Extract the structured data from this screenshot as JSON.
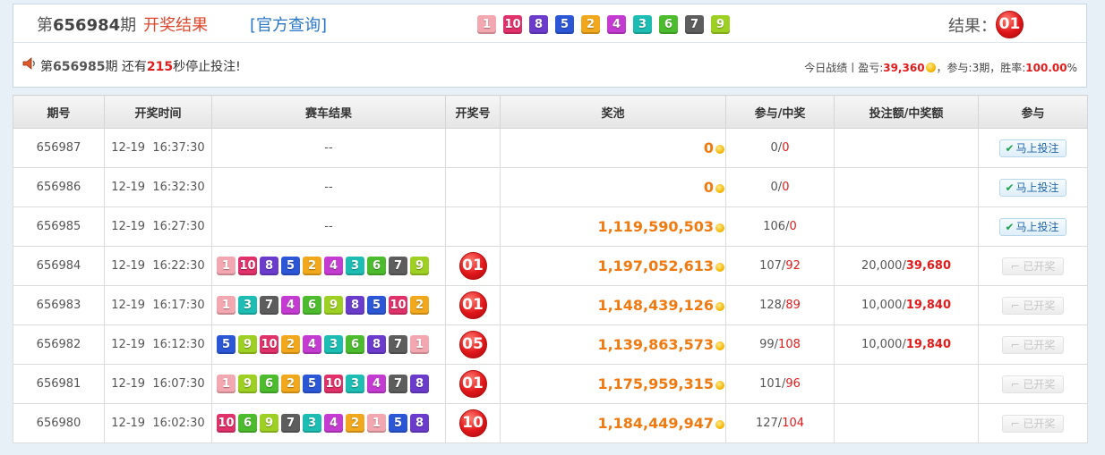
{
  "colors": {
    "1": "#f3a7b0",
    "2": "#f2a81c",
    "3": "#1dbdb3",
    "4": "#c33bd0",
    "5": "#2b57d6",
    "6": "#4cbc2e",
    "7": "#5d5d5d",
    "8": "#6b3ccc",
    "9": "#9dd022",
    "10": "#e0316a",
    "accent_red": "#e21b1b",
    "pool_orange": "#f07a10",
    "link_blue": "#2a76c8"
  },
  "header": {
    "issue_prefix": "第",
    "issue_number": "656984",
    "issue_suffix": "期",
    "result_title": "开奖结果",
    "official_link": "[官方查询]",
    "balls": [
      1,
      10,
      8,
      5,
      2,
      4,
      3,
      6,
      7,
      9
    ],
    "result_label": "结果：",
    "result_value": "01"
  },
  "notice": {
    "icon": "speaker-icon",
    "pre": "第",
    "issue": "656985",
    "mid": "期 还有",
    "seconds": "215",
    "post": "秒停止投注!"
  },
  "stats": {
    "label": "今日战绩丨盈亏:",
    "profit": "39,360",
    "join_label": "，参与:",
    "join_value": "3期",
    "rate_label": "，胜率:",
    "rate_value": "100.00",
    "rate_unit": "%"
  },
  "table": {
    "headers": [
      "期号",
      "开奖时间",
      "赛车结果",
      "开奖号",
      "奖池",
      "参与/中奖",
      "投注额/中奖额",
      "参与"
    ],
    "rows": [
      {
        "issue": "656987",
        "time": "12-19  16:37:30",
        "balls": [],
        "empty": "--",
        "result": "",
        "pool": "0",
        "join": "0",
        "win": "0",
        "bet": "",
        "prize": "",
        "action": "马上投注",
        "open": true
      },
      {
        "issue": "656986",
        "time": "12-19  16:32:30",
        "balls": [],
        "empty": "--",
        "result": "",
        "pool": "0",
        "join": "0",
        "win": "0",
        "bet": "",
        "prize": "",
        "action": "马上投注",
        "open": true
      },
      {
        "issue": "656985",
        "time": "12-19  16:27:30",
        "balls": [],
        "empty": "--",
        "result": "",
        "pool": "1,119,590,503",
        "join": "106",
        "win": "0",
        "bet": "",
        "prize": "",
        "action": "马上投注",
        "open": true
      },
      {
        "issue": "656984",
        "time": "12-19  16:22:30",
        "balls": [
          1,
          10,
          8,
          5,
          2,
          4,
          3,
          6,
          7,
          9
        ],
        "empty": "",
        "result": "01",
        "pool": "1,197,052,613",
        "join": "107",
        "win": "92",
        "bet": "20,000",
        "prize": "39,680",
        "action": "已开奖",
        "open": false
      },
      {
        "issue": "656983",
        "time": "12-19  16:17:30",
        "balls": [
          1,
          3,
          7,
          4,
          6,
          9,
          8,
          5,
          10,
          2
        ],
        "empty": "",
        "result": "01",
        "pool": "1,148,439,126",
        "join": "128",
        "win": "89",
        "bet": "10,000",
        "prize": "19,840",
        "action": "已开奖",
        "open": false
      },
      {
        "issue": "656982",
        "time": "12-19  16:12:30",
        "balls": [
          5,
          9,
          10,
          2,
          4,
          3,
          6,
          8,
          7,
          1
        ],
        "empty": "",
        "result": "05",
        "pool": "1,139,863,573",
        "join": "99",
        "win": "108",
        "bet": "10,000",
        "prize": "19,840",
        "action": "已开奖",
        "open": false
      },
      {
        "issue": "656981",
        "time": "12-19  16:07:30",
        "balls": [
          1,
          9,
          6,
          2,
          5,
          10,
          3,
          4,
          7,
          8
        ],
        "empty": "",
        "result": "01",
        "pool": "1,175,959,315",
        "join": "101",
        "win": "96",
        "bet": "",
        "prize": "",
        "action": "已开奖",
        "open": false
      },
      {
        "issue": "656980",
        "time": "12-19  16:02:30",
        "balls": [
          10,
          6,
          9,
          7,
          3,
          4,
          2,
          1,
          5,
          8
        ],
        "empty": "",
        "result": "10",
        "pool": "1,184,449,947",
        "join": "127",
        "win": "104",
        "bet": "",
        "prize": "",
        "action": "已开奖",
        "open": false
      }
    ]
  }
}
